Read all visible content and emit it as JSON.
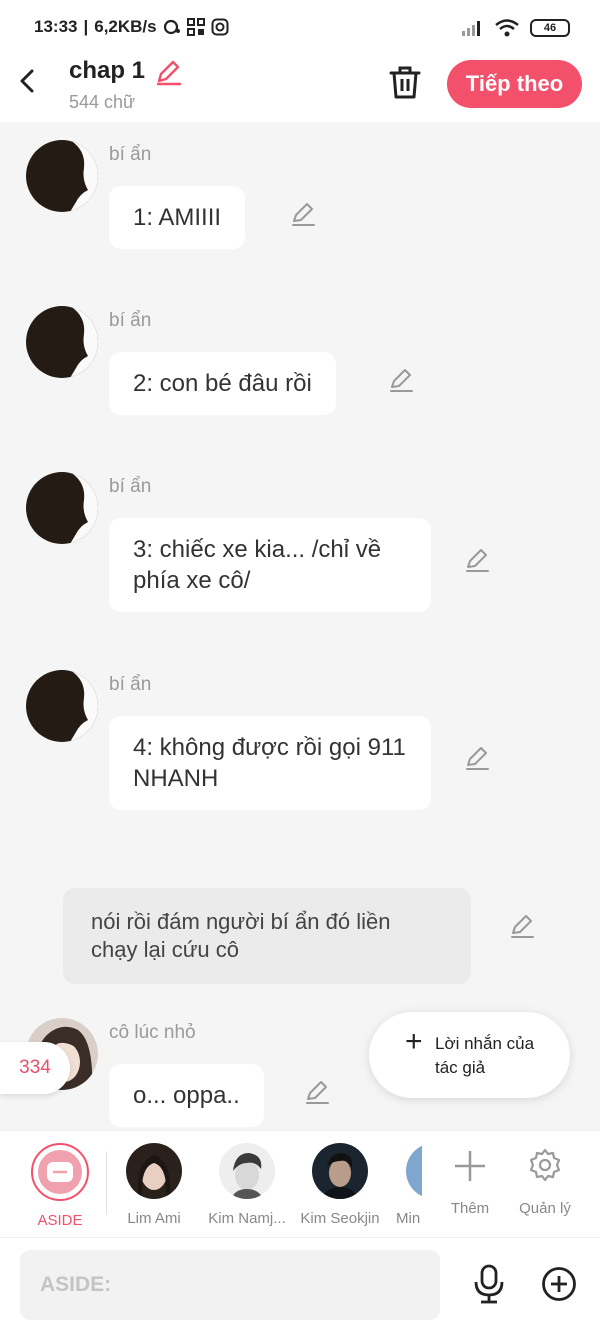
{
  "status_bar": {
    "time": "13:33",
    "net_speed": "6,2KB/s",
    "battery": "46"
  },
  "header": {
    "title": "chap 1",
    "word_count": "544 chữ",
    "next_label": "Tiếp theo"
  },
  "messages": [
    {
      "speaker": "bí ẩn",
      "text": "1: AMIIII"
    },
    {
      "speaker": "bí ẩn",
      "text": "2: con bé đâu rồi"
    },
    {
      "speaker": "bí ẩn",
      "text": "3: chiếc xe kia... /chỉ về phía xe cô/"
    },
    {
      "speaker": "bí ẩn",
      "text": "4: không được rồi gọi 911 NHANH"
    }
  ],
  "aside_message": "nói rồi đám người bí ẩn đó liền chạy lại cứu cô",
  "last_message": {
    "speaker": "cô lúc nhỏ",
    "text": "o... oppa.."
  },
  "message_count": "334",
  "author_note": {
    "label": "Lời nhắn của tác giả"
  },
  "characters": [
    {
      "name": "ASIDE"
    },
    {
      "name": "Lim Ami"
    },
    {
      "name": "Kim Namj..."
    },
    {
      "name": "Kim Seokjin"
    },
    {
      "name": "Min"
    }
  ],
  "tools": {
    "add_label": "Thêm",
    "manage_label": "Quản lý"
  },
  "input": {
    "placeholder": "ASIDE:"
  },
  "colors": {
    "accent": "#f2506b",
    "aside_bg": "#ebebeb",
    "page_bg": "#f5f5f5"
  }
}
